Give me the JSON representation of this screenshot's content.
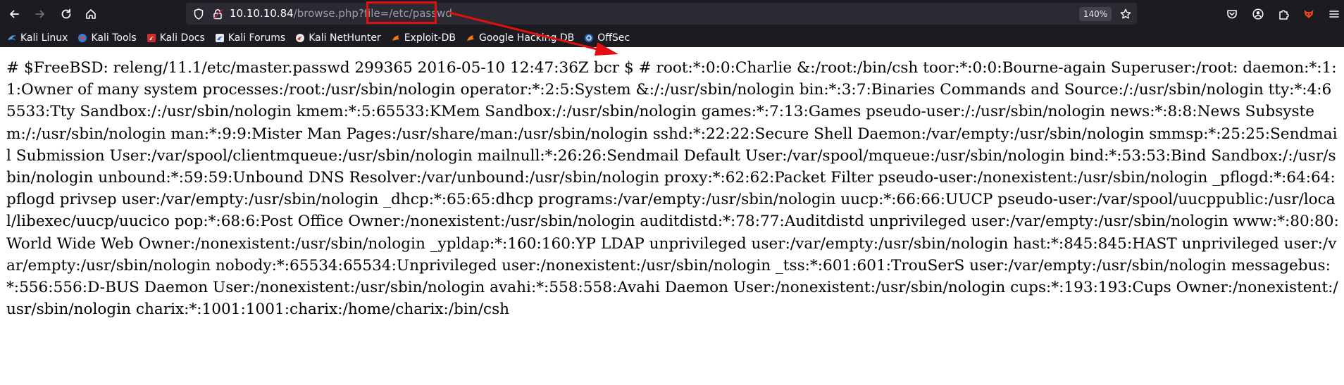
{
  "browser": {
    "url_host": "10.10.10.84",
    "url_rest": "/browse.php?file=/etc/passwd",
    "zoom": "140%",
    "icons": {
      "back": "back-arrow-icon",
      "forward": "forward-arrow-icon",
      "reload": "reload-icon",
      "home": "home-icon",
      "shield": "tracking-shield-icon",
      "insecure": "insecure-lock-icon",
      "bookmark_star": "star-icon",
      "pocket": "pocket-icon",
      "account": "account-icon",
      "extensions": "extensions-icon",
      "extension_fox": "fox-extension-icon",
      "menu": "hamburger-menu-icon"
    }
  },
  "bookmarks": [
    {
      "label": "Kali Linux",
      "icon": "kali-icon"
    },
    {
      "label": "Kali Tools",
      "icon": "kali-tools-icon"
    },
    {
      "label": "Kali Docs",
      "icon": "kali-docs-icon"
    },
    {
      "label": "Kali Forums",
      "icon": "kali-forums-icon"
    },
    {
      "label": "Kali NetHunter",
      "icon": "nethunter-icon"
    },
    {
      "label": "Exploit-DB",
      "icon": "exploit-db-icon"
    },
    {
      "label": "Google Hacking DB",
      "icon": "ghdb-icon"
    },
    {
      "label": "OffSec",
      "icon": "offsec-icon"
    }
  ],
  "page": {
    "text": "# $FreeBSD: releng/11.1/etc/master.passwd 299365 2016-05-10 12:47:36Z bcr $ # root:*:0:0:Charlie &:/root:/bin/csh toor:*:0:0:Bourne-again Superuser:/root: daemon:*:1:1:Owner of many system processes:/root:/usr/sbin/nologin operator:*:2:5:System &:/:/usr/sbin/nologin bin:*:3:7:Binaries Commands and Source:/:/usr/sbin/nologin tty:*:4:65533:Tty Sandbox:/:/usr/sbin/nologin kmem:*:5:65533:KMem Sandbox:/:/usr/sbin/nologin games:*:7:13:Games pseudo-user:/:/usr/sbin/nologin news:*:8:8:News Subsystem:/:/usr/sbin/nologin man:*:9:9:Mister Man Pages:/usr/share/man:/usr/sbin/nologin sshd:*:22:22:Secure Shell Daemon:/var/empty:/usr/sbin/nologin smmsp:*:25:25:Sendmail Submission User:/var/spool/clientmqueue:/usr/sbin/nologin mailnull:*:26:26:Sendmail Default User:/var/spool/mqueue:/usr/sbin/nologin bind:*:53:53:Bind Sandbox:/:/usr/sbin/nologin unbound:*:59:59:Unbound DNS Resolver:/var/unbound:/usr/sbin/nologin proxy:*:62:62:Packet Filter pseudo-user:/nonexistent:/usr/sbin/nologin _pflogd:*:64:64:pflogd privsep user:/var/empty:/usr/sbin/nologin _dhcp:*:65:65:dhcp programs:/var/empty:/usr/sbin/nologin uucp:*:66:66:UUCP pseudo-user:/var/spool/uucppublic:/usr/local/libexec/uucp/uucico pop:*:68:6:Post Office Owner:/nonexistent:/usr/sbin/nologin auditdistd:*:78:77:Auditdistd unprivileged user:/var/empty:/usr/sbin/nologin www:*:80:80:World Wide Web Owner:/nonexistent:/usr/sbin/nologin _ypldap:*:160:160:YP LDAP unprivileged user:/var/empty:/usr/sbin/nologin hast:*:845:845:HAST unprivileged user:/var/empty:/usr/sbin/nologin nobody:*:65534:65534:Unprivileged user:/nonexistent:/usr/sbin/nologin _tss:*:601:601:TrouSerS user:/var/empty:/usr/sbin/nologin messagebus:*:556:556:D-BUS Daemon User:/nonexistent:/usr/sbin/nologin avahi:*:558:558:Avahi Daemon User:/nonexistent:/usr/sbin/nologin cups:*:193:193:Cups Owner:/nonexistent:/usr/sbin/nologin charix:*:1001:1001:charix:/home/charix:/bin/csh"
  },
  "colors": {
    "chrome_bg": "#1c1b22",
    "urlbar_bg": "#2b2a33",
    "annotation_red": "#e10f0f"
  }
}
